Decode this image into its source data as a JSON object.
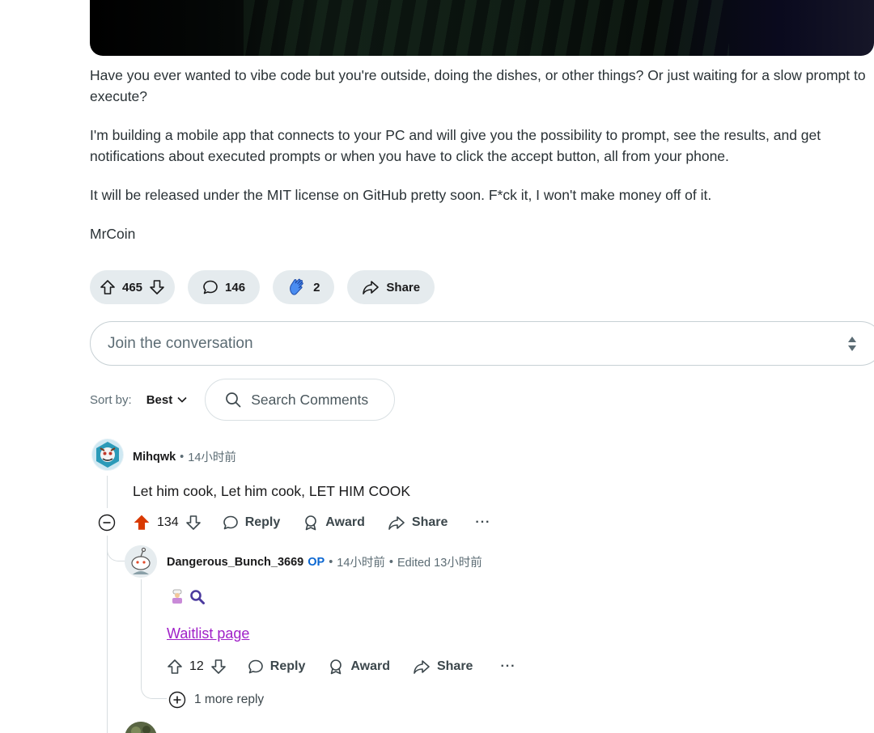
{
  "post": {
    "paragraphs": [
      "Have you ever wanted to vibe code but you're outside, doing the dishes, or other things? Or just waiting for a slow prompt to execute?",
      "I'm building a mobile app that connects to your PC and will give you the possibility to prompt, see the results, and get notifications about executed prompts or when you have to click the accept button, all from your phone.",
      "It will be released under the MIT license on GitHub pretty soon. F*ck it, I won't make money off of it.",
      "MrCoin"
    ],
    "votes": "465",
    "comments": "146",
    "awards": "2",
    "share_label": "Share"
  },
  "composer": {
    "placeholder": "Join the conversation"
  },
  "sort": {
    "label": "Sort by:",
    "value": "Best",
    "search_placeholder": "Search Comments"
  },
  "comments": [
    {
      "author": "Mihqwk",
      "time": "14小时前",
      "text": "Let him cook, Let him cook, LET HIM COOK",
      "score": "134",
      "reply": "Reply",
      "award": "Award",
      "share": "Share"
    },
    {
      "author": "Dangerous_Bunch_3669",
      "op": "OP",
      "time": "14小时前",
      "edited": "Edited 13小时前",
      "link": "Waitlist page",
      "score": "12",
      "reply": "Reply",
      "award": "Award",
      "share": "Share",
      "more_replies": "1 more reply"
    }
  ],
  "colors": {
    "upvoted": "#d93900",
    "op": "#0a66d1",
    "link_visited": "#a020c8",
    "pill_bg": "#e5ebee"
  }
}
